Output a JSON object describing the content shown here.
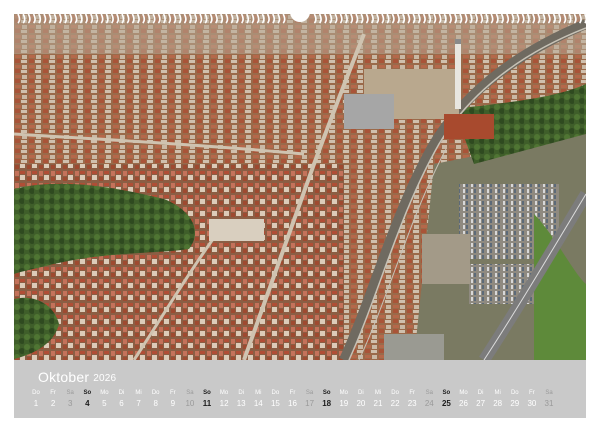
{
  "photo": {
    "icon": "aerial-city-photo"
  },
  "binding": {
    "icon": "spiral-binding-icon"
  },
  "calendar": {
    "month": "Oktober",
    "year": "2026",
    "days": [
      {
        "wd": "Do",
        "num": "1",
        "type": "weekday"
      },
      {
        "wd": "Fr",
        "num": "2",
        "type": "weekday"
      },
      {
        "wd": "Sa",
        "num": "3",
        "type": "sat"
      },
      {
        "wd": "So",
        "num": "4",
        "type": "sun"
      },
      {
        "wd": "Mo",
        "num": "5",
        "type": "weekday"
      },
      {
        "wd": "Di",
        "num": "6",
        "type": "weekday"
      },
      {
        "wd": "Mi",
        "num": "7",
        "type": "weekday"
      },
      {
        "wd": "Do",
        "num": "8",
        "type": "weekday"
      },
      {
        "wd": "Fr",
        "num": "9",
        "type": "weekday"
      },
      {
        "wd": "Sa",
        "num": "10",
        "type": "sat"
      },
      {
        "wd": "So",
        "num": "11",
        "type": "sun"
      },
      {
        "wd": "Mo",
        "num": "12",
        "type": "weekday"
      },
      {
        "wd": "Di",
        "num": "13",
        "type": "weekday"
      },
      {
        "wd": "Mi",
        "num": "14",
        "type": "weekday"
      },
      {
        "wd": "Do",
        "num": "15",
        "type": "weekday"
      },
      {
        "wd": "Fr",
        "num": "16",
        "type": "weekday"
      },
      {
        "wd": "Sa",
        "num": "17",
        "type": "sat"
      },
      {
        "wd": "So",
        "num": "18",
        "type": "sun"
      },
      {
        "wd": "Mo",
        "num": "19",
        "type": "weekday"
      },
      {
        "wd": "Di",
        "num": "20",
        "type": "weekday"
      },
      {
        "wd": "Mi",
        "num": "21",
        "type": "weekday"
      },
      {
        "wd": "Do",
        "num": "22",
        "type": "weekday"
      },
      {
        "wd": "Fr",
        "num": "23",
        "type": "weekday"
      },
      {
        "wd": "Sa",
        "num": "24",
        "type": "sat"
      },
      {
        "wd": "So",
        "num": "25",
        "type": "sun"
      },
      {
        "wd": "Mo",
        "num": "26",
        "type": "weekday"
      },
      {
        "wd": "Di",
        "num": "27",
        "type": "weekday"
      },
      {
        "wd": "Mi",
        "num": "28",
        "type": "weekday"
      },
      {
        "wd": "Do",
        "num": "29",
        "type": "weekday"
      },
      {
        "wd": "Fr",
        "num": "30",
        "type": "weekday"
      },
      {
        "wd": "Sa",
        "num": "31",
        "type": "sat"
      }
    ]
  }
}
